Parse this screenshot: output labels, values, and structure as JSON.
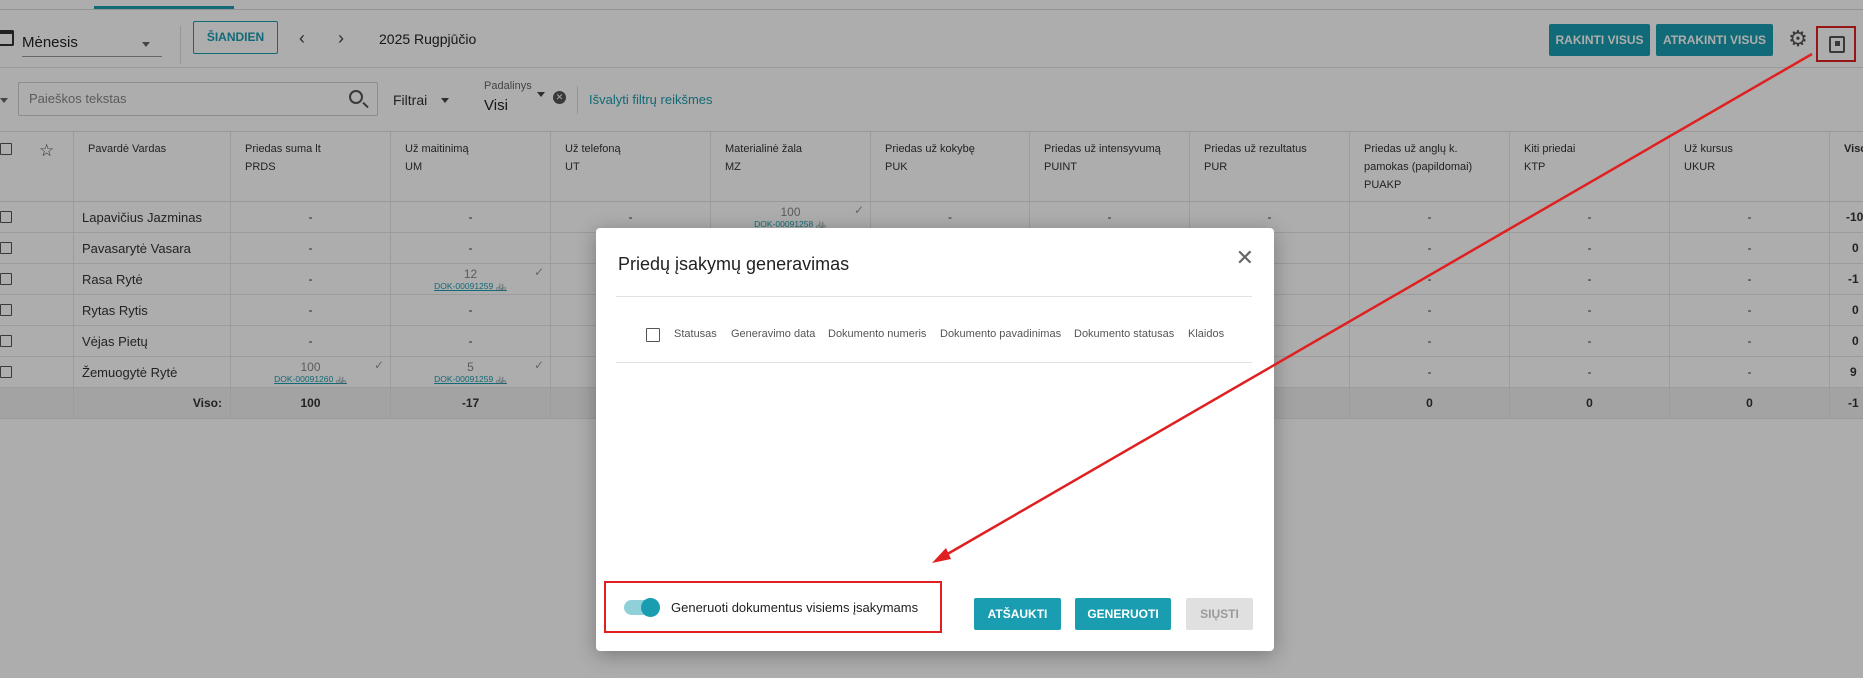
{
  "toolbar": {
    "view_label": "Mėnesis",
    "today_label": "ŠIANDIEN",
    "prev_arrow": "‹",
    "next_arrow": "›",
    "period": "2025 Rugpjūčio",
    "lock_all_label": "RAKINTI VISUS",
    "unlock_all_label": "ATRAKINTI VISUS",
    "gear_glyph": "⚙"
  },
  "filters": {
    "search_placeholder": "Paieškos tekstas",
    "filters_label": "Filtrai",
    "padalinys_label": "Padalinys",
    "padalinys_value": "Visi",
    "clear_glyph": "✕",
    "reset_label": "Išvalyti filtrų reikšmes"
  },
  "table": {
    "star_glyph": "☆",
    "columns": [
      {
        "title": "Pavardė Vardas",
        "code": ""
      },
      {
        "title": "Priedas suma lt",
        "code": "PRDS"
      },
      {
        "title": "Už maitinimą",
        "code": "UM"
      },
      {
        "title": "Už telefoną",
        "code": "UT"
      },
      {
        "title": "Materialinė žala",
        "code": "MZ"
      },
      {
        "title": "Priedas už kokybę",
        "code": "PUK"
      },
      {
        "title": "Priedas už intensyvumą",
        "code": "PUINT"
      },
      {
        "title": "Priedas už rezultatus",
        "code": "PUR"
      },
      {
        "title": "Priedas už anglų k. pamokas (papildomai)",
        "code": "PUAKP"
      },
      {
        "title": "Kiti priedai",
        "code": "KTP"
      },
      {
        "title": "Už kursus",
        "code": "UKUR"
      },
      {
        "title": "Viso",
        "code": ""
      }
    ],
    "rows": [
      {
        "name": "Lapavičius Jazminas",
        "cells": [
          "-",
          "-",
          "-",
          "",
          "-",
          "-",
          "-",
          "-",
          "-",
          "-",
          "-10"
        ]
      },
      {
        "name": "Pavasarytė Vasara",
        "cells": [
          "-",
          "-",
          "",
          "",
          "",
          "",
          "",
          "-",
          "-",
          "-",
          "0"
        ]
      },
      {
        "name": "Rasa Rytė",
        "cells": [
          "-",
          "",
          "",
          "",
          "",
          "",
          "",
          "-",
          "-",
          "-",
          "-1"
        ]
      },
      {
        "name": "Rytas Rytis",
        "cells": [
          "-",
          "-",
          "",
          "",
          "",
          "",
          "",
          "-",
          "-",
          "-",
          "0"
        ]
      },
      {
        "name": "Vėjas Pietų",
        "cells": [
          "-",
          "-",
          "",
          "",
          "",
          "",
          "",
          "-",
          "-",
          "-",
          "0"
        ]
      },
      {
        "name": "Žemuogytė Rytė",
        "cells": [
          "",
          "",
          "",
          "",
          "",
          "",
          "",
          "-",
          "-",
          "-",
          "9"
        ]
      }
    ],
    "stacked": {
      "mz_row0": {
        "value": "100",
        "doc": "DOK-00091258"
      },
      "um_row2": {
        "value": "12",
        "doc": "DOK-00091259"
      },
      "prds_row5": {
        "value": "100",
        "doc": "DOK-00091260"
      },
      "um_row5": {
        "value": "5",
        "doc": "DOK-00091259"
      }
    },
    "totals": {
      "label": "Viso:",
      "prds": "100",
      "um": "-17",
      "puakp": "0",
      "ktp": "0",
      "ukur": "0",
      "viso": "-1"
    },
    "check_glyph": "✓",
    "bike_glyph": "🚲"
  },
  "modal": {
    "title": "Priedų įsakymų generavimas",
    "close_glyph": "✕",
    "headers": [
      "Statusas",
      "Generavimo data",
      "Dokumento numeris",
      "Dokumento pavadinimas",
      "Dokumento statusas",
      "Klaidos"
    ],
    "toggle_label": "Generuoti dokumentus visiems įsakymams",
    "toggle_on": true,
    "cancel_label": "ATŠAUKTI",
    "generate_label": "GENERUOTI",
    "send_label": "SIŲSTI"
  },
  "colors": {
    "accent": "#1a9db0",
    "annotation": "#e02020"
  }
}
